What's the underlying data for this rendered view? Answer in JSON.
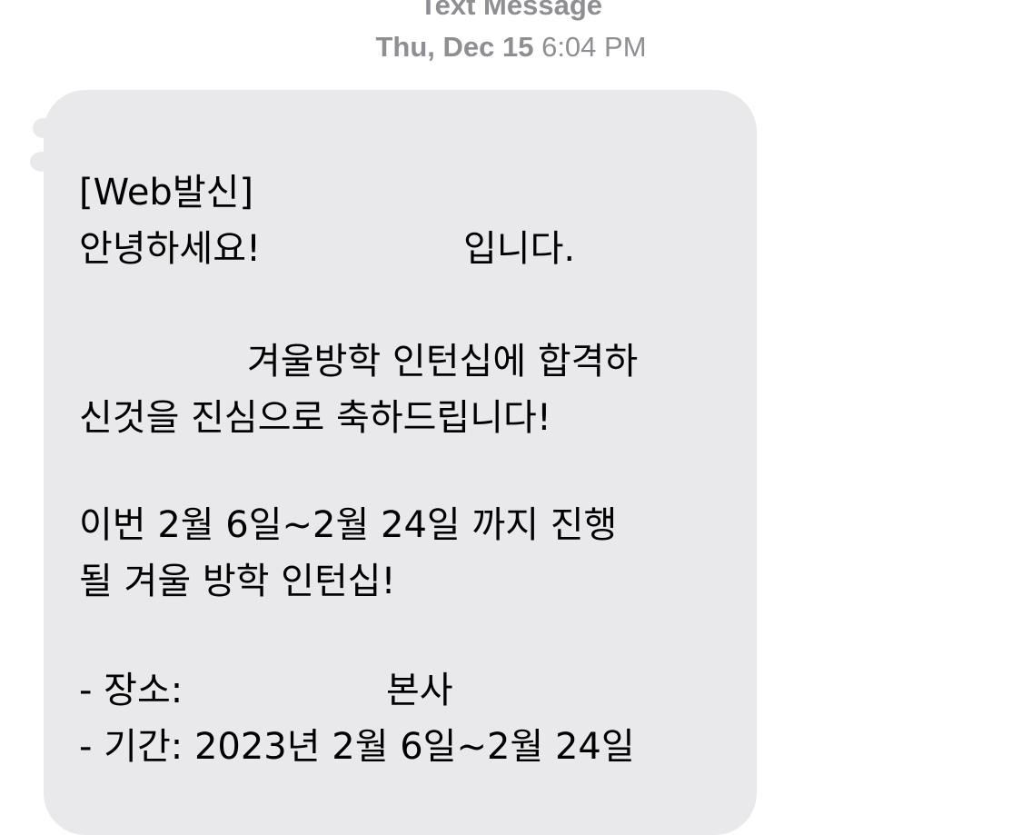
{
  "header": {
    "service": "Text Message",
    "timestamp_day": "Thu, Dec 15",
    "timestamp_time": "6:04 PM"
  },
  "message": {
    "line1": "[Web발신]",
    "line2a": "안녕하세요!",
    "line2b": "입니다.",
    "line3": "겨울방학 인턴십에 합격하",
    "line4": "신것을 진심으로 축하드립니다!",
    "line5": "이번 2월 6일~2월 24일 까지 진행",
    "line6": "될 겨울 방학 인턴십!",
    "line7a": "- 장소:",
    "line7b": "본사",
    "line8": "- 기간: 2023년 2월 6일~2월 24일"
  },
  "colors": {
    "bubble": "#e9e9eb",
    "meta_text": "#8e8e93",
    "text": "#000000"
  }
}
